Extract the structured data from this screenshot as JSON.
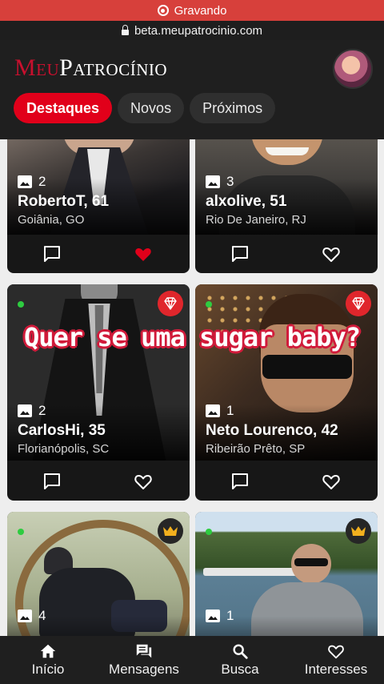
{
  "recording": {
    "label": "Gravando"
  },
  "browser": {
    "url": "beta.meupatrocinio.com"
  },
  "brand": {
    "part1": "Meu",
    "part2": "Patrocínio"
  },
  "tabs": [
    {
      "label": "Destaques",
      "active": true
    },
    {
      "label": "Novos",
      "active": false
    },
    {
      "label": "Próximos",
      "active": false
    }
  ],
  "profiles": [
    {
      "photos": "2",
      "name": "RobertoT, 61",
      "city": "Goiânia, GO",
      "liked": true
    },
    {
      "photos": "3",
      "name": "alxolive, 51",
      "city": "Rio De Janeiro, RJ",
      "liked": false
    },
    {
      "photos": "2",
      "name": "CarlosHi, 35",
      "city": "Florianópolis, SC",
      "liked": false,
      "online": true,
      "badge": "diamond-icon"
    },
    {
      "photos": "1",
      "name": "Neto Lourenco, 42",
      "city": "Ribeirão Prêto, SP",
      "liked": false,
      "online": true,
      "badge": "diamond-icon"
    },
    {
      "photos": "4",
      "online": true,
      "badge": "crown-icon"
    },
    {
      "photos": "1",
      "online": true,
      "badge": "crown-icon"
    }
  ],
  "overlay": {
    "text": "Quer se uma sugar baby?"
  },
  "nav": [
    {
      "label": "Início",
      "icon": "home-icon"
    },
    {
      "label": "Mensagens",
      "icon": "messages-icon"
    },
    {
      "label": "Busca",
      "icon": "search-icon"
    },
    {
      "label": "Interesses",
      "icon": "heart-icon"
    }
  ],
  "colors": {
    "accent": "#e1001a",
    "recording": "#d7403b",
    "background": "#1f1f1f"
  }
}
